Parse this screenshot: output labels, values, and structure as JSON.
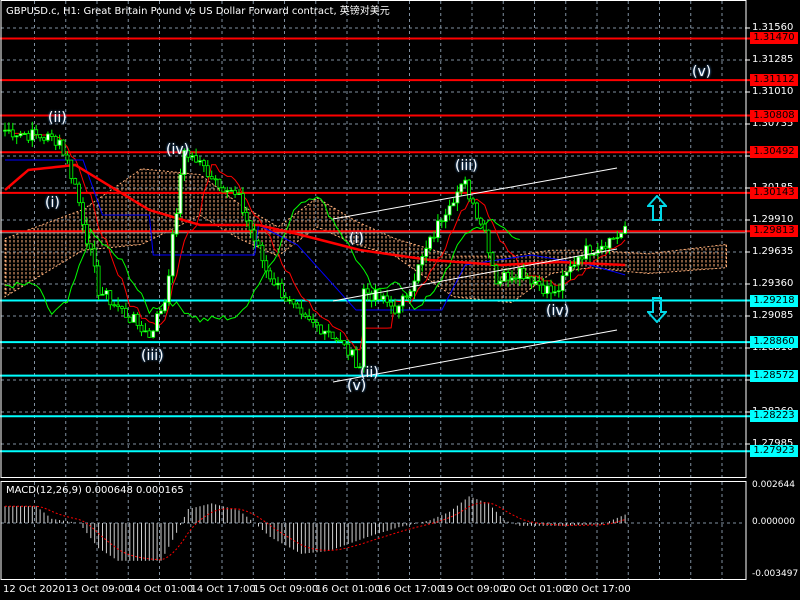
{
  "title": "GBPUSD.c, H1:  Great Britain Pound vs US Dollar Forward contract, 英镑对美元",
  "price_axis": [
    "1.31560",
    "1.31285",
    "1.31010",
    "1.30735",
    "1.30460",
    "1.30185",
    "1.29910",
    "1.29635",
    "1.29360",
    "1.29085",
    "1.28810",
    "1.28535",
    "1.28260",
    "1.27985"
  ],
  "resistance_levels": [
    "1.31470",
    "1.31112",
    "1.30808",
    "1.30492",
    "1.30143",
    "1.29813"
  ],
  "support_levels": [
    "1.29218",
    "1.28860",
    "1.28572",
    "1.28223",
    "1.27923"
  ],
  "current_price": 1.298,
  "colors": {
    "resistance": "#ff0000",
    "support": "#00ffff",
    "bull": "#00ff00",
    "ma": "#ff0000",
    "kijun": "#0000ff",
    "cloud": "#ffb07a",
    "grid": "#8090a0"
  },
  "wave_labels": [
    {
      "text": "(ii)",
      "id": "w1"
    },
    {
      "text": "(i)",
      "id": "w2"
    },
    {
      "text": "(iii)",
      "id": "w3"
    },
    {
      "text": "(iv)",
      "id": "w4"
    },
    {
      "text": "(i)",
      "id": "w5"
    },
    {
      "text": "(iii)",
      "id": "w6"
    },
    {
      "text": "(v)",
      "id": "w7"
    },
    {
      "text": "(ii)",
      "id": "w8"
    },
    {
      "text": "(iv)",
      "id": "w9"
    },
    {
      "text": "(v)",
      "id": "w10"
    }
  ],
  "time_labels": [
    "12 Oct 2020",
    "13 Oct 09:00",
    "14 Oct 01:00",
    "14 Oct 17:00",
    "15 Oct 09:00",
    "16 Oct 01:00",
    "16 Oct 17:00",
    "19 Oct 09:00",
    "20 Oct 01:00",
    "20 Oct 17:00"
  ],
  "macd": {
    "label": "MACD(12,26,9) 0.000648 0.000165",
    "axis": [
      "0.002644",
      "0.000000",
      "-0.003497"
    ]
  },
  "chart_data": {
    "type": "line",
    "title": "GBPUSD.c H1",
    "ylim": [
      1.2775,
      1.317
    ],
    "price_waypoints": [
      [
        0,
        1.30683
      ],
      [
        14,
        1.30597
      ],
      [
        18,
        1.30211
      ],
      [
        24,
        1.29308
      ],
      [
        37,
        1.28922
      ],
      [
        41,
        1.29222
      ],
      [
        46,
        1.30512
      ],
      [
        60,
        1.30082
      ],
      [
        67,
        1.2948
      ],
      [
        76,
        1.2905
      ],
      [
        83,
        1.28964
      ],
      [
        91,
        1.28664
      ],
      [
        92,
        1.29308
      ],
      [
        101,
        1.29136
      ],
      [
        114,
        1.30082
      ],
      [
        118,
        1.30211
      ],
      [
        123,
        1.29824
      ],
      [
        126,
        1.29394
      ],
      [
        132,
        1.2948
      ],
      [
        141,
        1.29265
      ],
      [
        147,
        1.29609
      ],
      [
        159,
        1.29807
      ]
    ],
    "ma_waypoints": [
      [
        0,
        1.30168
      ],
      [
        6,
        1.3034
      ],
      [
        18,
        1.30383
      ],
      [
        37,
        1.29996
      ],
      [
        50,
        1.29867
      ],
      [
        65,
        1.29867
      ],
      [
        76,
        1.29781
      ],
      [
        91,
        1.29652
      ],
      [
        109,
        1.29566
      ],
      [
        127,
        1.29523
      ],
      [
        142,
        1.29549
      ],
      [
        159,
        1.29523
      ]
    ],
    "kijun_waypoints": [
      [
        0,
        1.30426
      ],
      [
        20,
        1.30426
      ],
      [
        25,
        1.29953
      ],
      [
        37,
        1.29953
      ],
      [
        38,
        1.29609
      ],
      [
        64,
        1.29609
      ],
      [
        65,
        1.29867
      ],
      [
        75,
        1.29695
      ],
      [
        90,
        1.29136
      ],
      [
        112,
        1.29136
      ],
      [
        118,
        1.29524
      ],
      [
        135,
        1.29609
      ],
      [
        150,
        1.29524
      ],
      [
        159,
        1.29438
      ]
    ],
    "chikou_waypoints": [
      [
        0,
        1.2935
      ],
      [
        8,
        1.2935
      ],
      [
        12,
        1.291
      ],
      [
        16,
        1.292
      ],
      [
        22,
        1.298
      ],
      [
        30,
        1.2955
      ],
      [
        37,
        1.2913
      ],
      [
        42,
        1.2922
      ],
      [
        50,
        1.2905
      ],
      [
        60,
        1.2908
      ],
      [
        70,
        1.2965
      ],
      [
        75,
        1.3005
      ],
      [
        80,
        1.3013
      ],
      [
        88,
        1.297
      ],
      [
        95,
        1.2928
      ],
      [
        100,
        1.294
      ],
      [
        105,
        1.2915
      ],
      [
        110,
        1.2928
      ],
      [
        118,
        1.298
      ],
      [
        125,
        1.299
      ],
      [
        132,
        1.2975
      ]
    ],
    "cloud": [
      [
        0,
        1.2975,
        1.2925
      ],
      [
        20,
        1.3,
        1.2965
      ],
      [
        35,
        1.3035,
        1.297
      ],
      [
        50,
        1.303,
        1.2995
      ],
      [
        60,
        1.3005,
        1.2975
      ],
      [
        70,
        1.2985,
        1.296
      ],
      [
        80,
        1.301,
        1.2985
      ],
      [
        90,
        1.299,
        1.297
      ],
      [
        100,
        1.2975,
        1.296
      ],
      [
        115,
        1.296,
        1.2925
      ],
      [
        130,
        1.296,
        1.292
      ],
      [
        140,
        1.2965,
        1.2945
      ],
      [
        150,
        1.2965,
        1.295
      ],
      [
        165,
        1.2962,
        1.2945
      ],
      [
        185,
        1.297,
        1.295
      ]
    ],
    "macd_waypoints": [
      [
        0,
        0.0012
      ],
      [
        8,
        0.0012
      ],
      [
        12,
        0.0003
      ],
      [
        19,
        0.0
      ],
      [
        24,
        -0.0018
      ],
      [
        29,
        -0.0027
      ],
      [
        40,
        -0.0027
      ],
      [
        44,
        -0.0007
      ],
      [
        47,
        0.001
      ],
      [
        53,
        0.0014
      ],
      [
        60,
        0.0009
      ],
      [
        64,
        0.0
      ],
      [
        68,
        -0.001
      ],
      [
        76,
        -0.0022
      ],
      [
        83,
        -0.002
      ],
      [
        94,
        -0.0009
      ],
      [
        101,
        -0.0003
      ],
      [
        109,
        0.0002
      ],
      [
        114,
        0.0008
      ],
      [
        119,
        0.0019
      ],
      [
        124,
        0.0014
      ],
      [
        128,
        0.0002
      ],
      [
        132,
        -0.0002
      ],
      [
        142,
        -0.0002
      ],
      [
        153,
        -0.0001
      ],
      [
        159,
        0.0006
      ]
    ],
    "macd_ylim": [
      -0.003497,
      0.002644
    ]
  }
}
